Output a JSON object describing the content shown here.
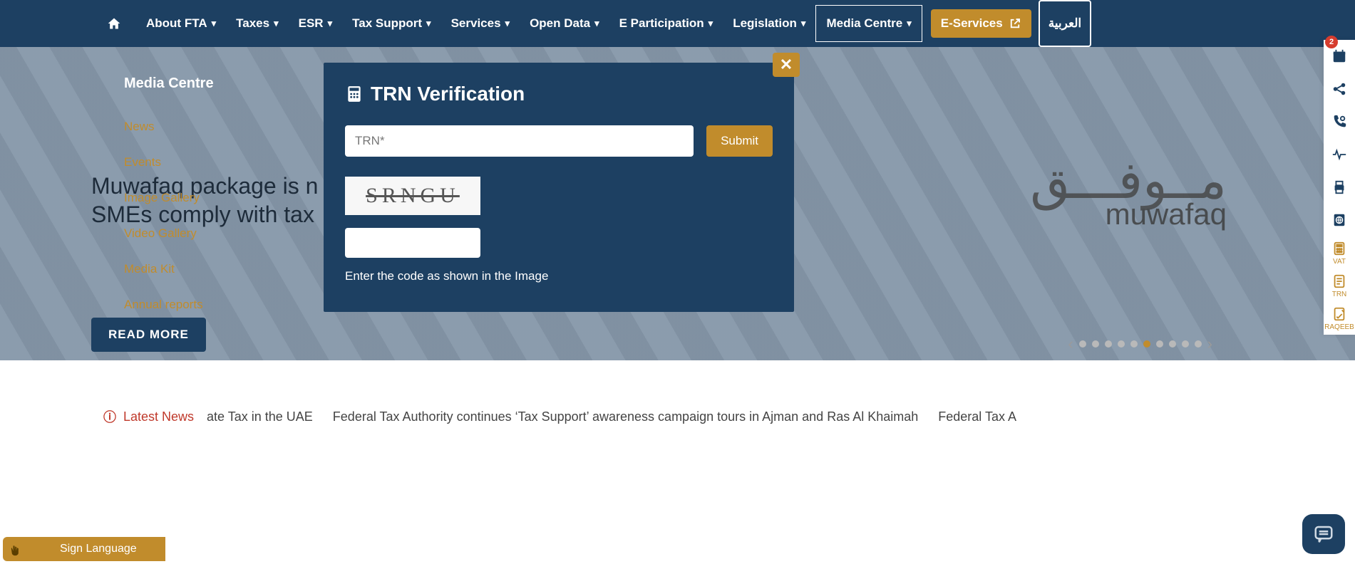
{
  "nav": {
    "items": [
      {
        "label": "About FTA"
      },
      {
        "label": "Taxes"
      },
      {
        "label": "ESR"
      },
      {
        "label": "Tax Support"
      },
      {
        "label": "Services"
      },
      {
        "label": "Open Data"
      },
      {
        "label": "E Participation"
      },
      {
        "label": "Legislation"
      }
    ],
    "media_centre": "Media Centre",
    "eservices": "E-Services",
    "arabic": "العربية"
  },
  "hero": {
    "headline_line1": "Muwafaq package is n",
    "headline_line2": "SMEs comply with tax",
    "read_more": "READ MORE",
    "brand_top": "مــوفـــق",
    "brand_bottom": "muwafaq"
  },
  "media_dropdown": {
    "title": "Media Centre",
    "items": [
      "News",
      "Events",
      "Image Gallery",
      "Video Gallery",
      "Media Kit",
      "Annual reports"
    ]
  },
  "modal": {
    "title": "TRN Verification",
    "trn_placeholder": "TRN*",
    "submit": "Submit",
    "captcha_text": "SRNGU",
    "captcha_instruction": "Enter the code as shown in the Image"
  },
  "news": {
    "label": "Latest News",
    "ticker": "ate Tax in the UAE   Federal Tax Authority continues ‘Tax Support’ awareness campaign tours in Ajman and Ras Al Khaimah   Federal Tax A"
  },
  "side_rail": {
    "badge": "2",
    "vat": "VAT",
    "trn": "TRN",
    "raqeeb": "RAQEEB"
  },
  "sign_language": "Sign Language",
  "carousel": {
    "total": 10,
    "active_index": 5
  }
}
